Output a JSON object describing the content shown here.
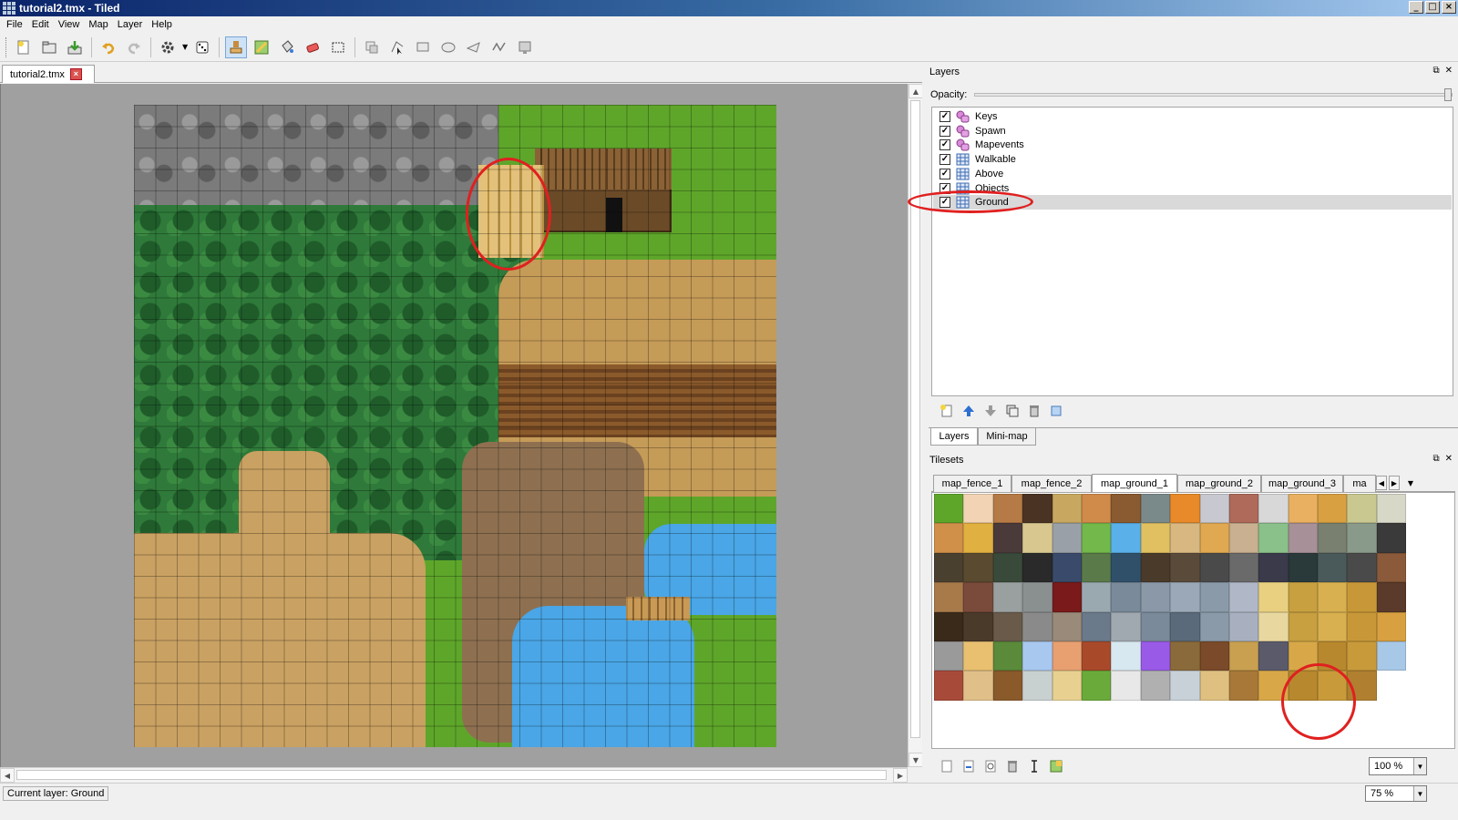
{
  "window": {
    "title": "tutorial2.tmx - Tiled"
  },
  "menu": [
    "File",
    "Edit",
    "View",
    "Map",
    "Layer",
    "Help"
  ],
  "toolbar": {
    "groups": [
      [
        "new-map-icon",
        "open-file-icon",
        "save-file-icon"
      ],
      [
        "undo-icon",
        "redo-icon"
      ],
      [
        "command-gear-icon",
        "random-dice-icon"
      ],
      [
        "stamp-brush-icon",
        "terrain-brush-icon",
        "bucket-fill-icon",
        "eraser-icon",
        "rectangular-select-icon"
      ],
      [
        "select-objects-icon",
        "edit-polygons-icon",
        "insert-rectangle-icon",
        "insert-ellipse-icon",
        "insert-polygon-icon",
        "insert-polyline-icon",
        "insert-tile-icon"
      ]
    ],
    "active": "stamp-brush-icon"
  },
  "document": {
    "tab_label": "tutorial2.tmx"
  },
  "layers_panel": {
    "title": "Layers",
    "opacity_label": "Opacity:",
    "opacity_value": 1.0,
    "layers": [
      {
        "name": "Keys",
        "type": "object",
        "visible": true,
        "selected": false
      },
      {
        "name": "Spawn",
        "type": "object",
        "visible": true,
        "selected": false
      },
      {
        "name": "Mapevents",
        "type": "object",
        "visible": true,
        "selected": false
      },
      {
        "name": "Walkable",
        "type": "tile",
        "visible": true,
        "selected": false
      },
      {
        "name": "Above",
        "type": "tile",
        "visible": true,
        "selected": false
      },
      {
        "name": "Objects",
        "type": "tile",
        "visible": true,
        "selected": false
      },
      {
        "name": "Ground",
        "type": "tile",
        "visible": true,
        "selected": true
      }
    ],
    "tabs": [
      "Layers",
      "Mini-map"
    ],
    "active_tab": "Layers"
  },
  "tilesets_panel": {
    "title": "Tilesets",
    "tabs": [
      "map_fence_1",
      "map_fence_2",
      "map_ground_1",
      "map_ground_2",
      "map_ground_3",
      "ma"
    ],
    "active_tab": "map_ground_1",
    "zoom": "100 %"
  },
  "status": {
    "current_layer": "Current layer: Ground",
    "zoom": "75 %"
  },
  "colors": {
    "highlight_circle": "#e02020",
    "grass": "#5ea62a",
    "dirt": "#c9a162",
    "water": "#4aa6e6",
    "rock": "#7b7b7b"
  }
}
